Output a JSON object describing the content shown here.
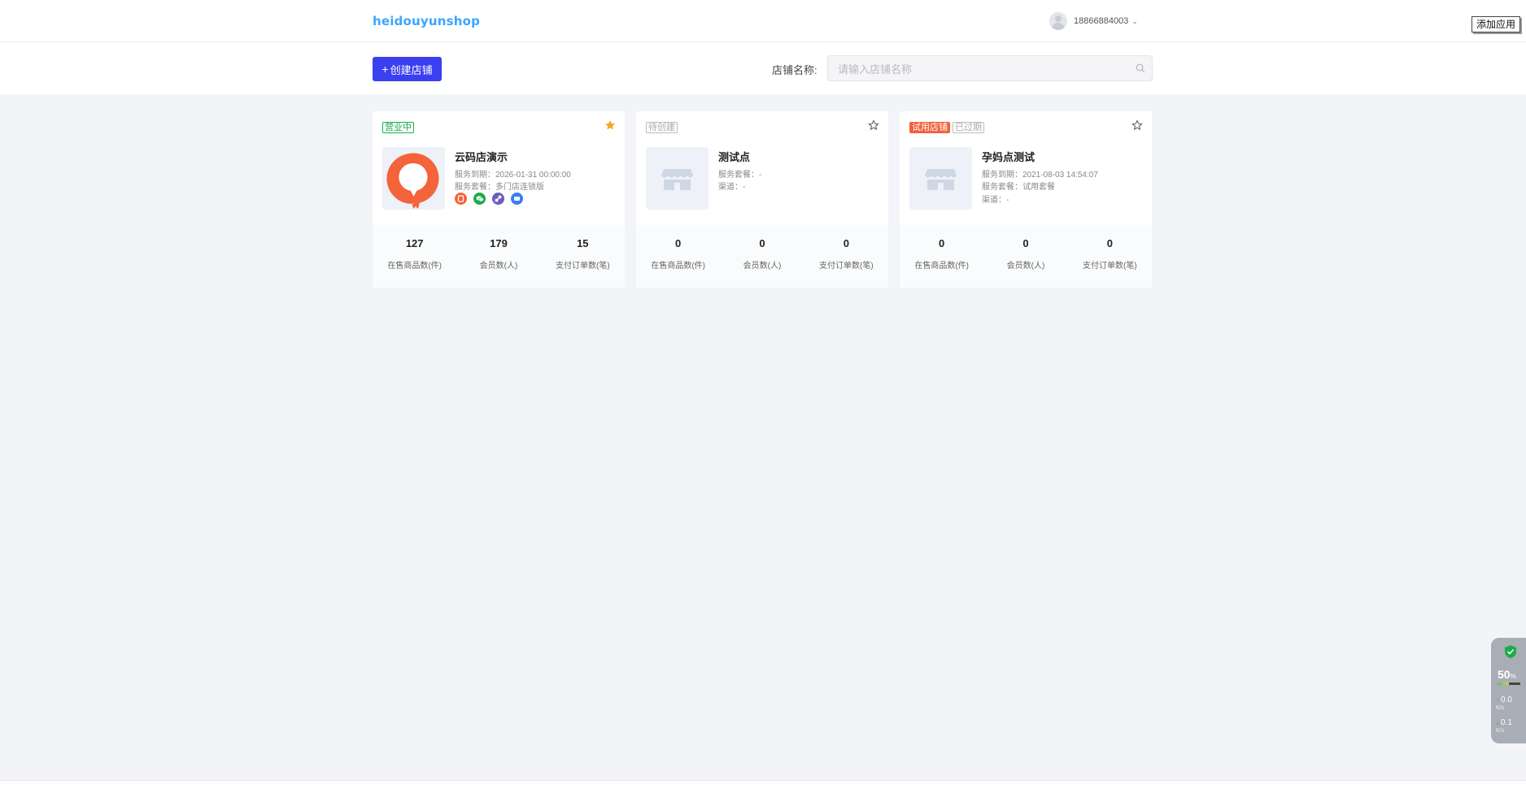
{
  "header": {
    "logo": "heidouyunshop",
    "user": "18866884003",
    "add_app": "添加应用"
  },
  "toolbar": {
    "create_label": "创建店铺",
    "search_label": "店铺名称:",
    "search_placeholder": "请输入店铺名称",
    "search_value": ""
  },
  "cards": [
    {
      "tags": [
        "营业中"
      ],
      "name": "云码店演示",
      "meta1": "服务到期：2026-01-31 00:00:00",
      "meta2": "服务套餐：多门店连锁版",
      "starred": true,
      "stats": [
        {
          "num": "127",
          "label": "在售商品数(件)"
        },
        {
          "num": "179",
          "label": "会员数(人)"
        },
        {
          "num": "15",
          "label": "支付订单数(笔)"
        }
      ]
    },
    {
      "tags": [
        "待创建"
      ],
      "name": "测试点",
      "meta1": "服务套餐：-",
      "meta2": "渠道：-",
      "starred": false,
      "stats": [
        {
          "num": "0",
          "label": "在售商品数(件)"
        },
        {
          "num": "0",
          "label": "会员数(人)"
        },
        {
          "num": "0",
          "label": "支付订单数(笔)"
        }
      ]
    },
    {
      "tags": [
        "试用店铺",
        "已过期"
      ],
      "name": "孕妈点测试",
      "meta1": "服务到期：2021-08-03 14:54:07",
      "meta2": "服务套餐：试用套餐",
      "meta3": "渠道：-",
      "starred": false,
      "stats": [
        {
          "num": "0",
          "label": "在售商品数(件)"
        },
        {
          "num": "0",
          "label": "会员数(人)"
        },
        {
          "num": "0",
          "label": "支付订单数(笔)"
        }
      ]
    }
  ],
  "monitor": {
    "pct": "50",
    "pct_unit": "%",
    "up": "0.0",
    "down": "0.1",
    "unit": "K/s",
    "memory_level": 0.5
  },
  "colors": {
    "primary": "#3a3ff0",
    "tag_green": "#1aad4a",
    "tag_red": "#f0613c",
    "star_active": "#f5a623",
    "logo": "#3aa6ff"
  }
}
